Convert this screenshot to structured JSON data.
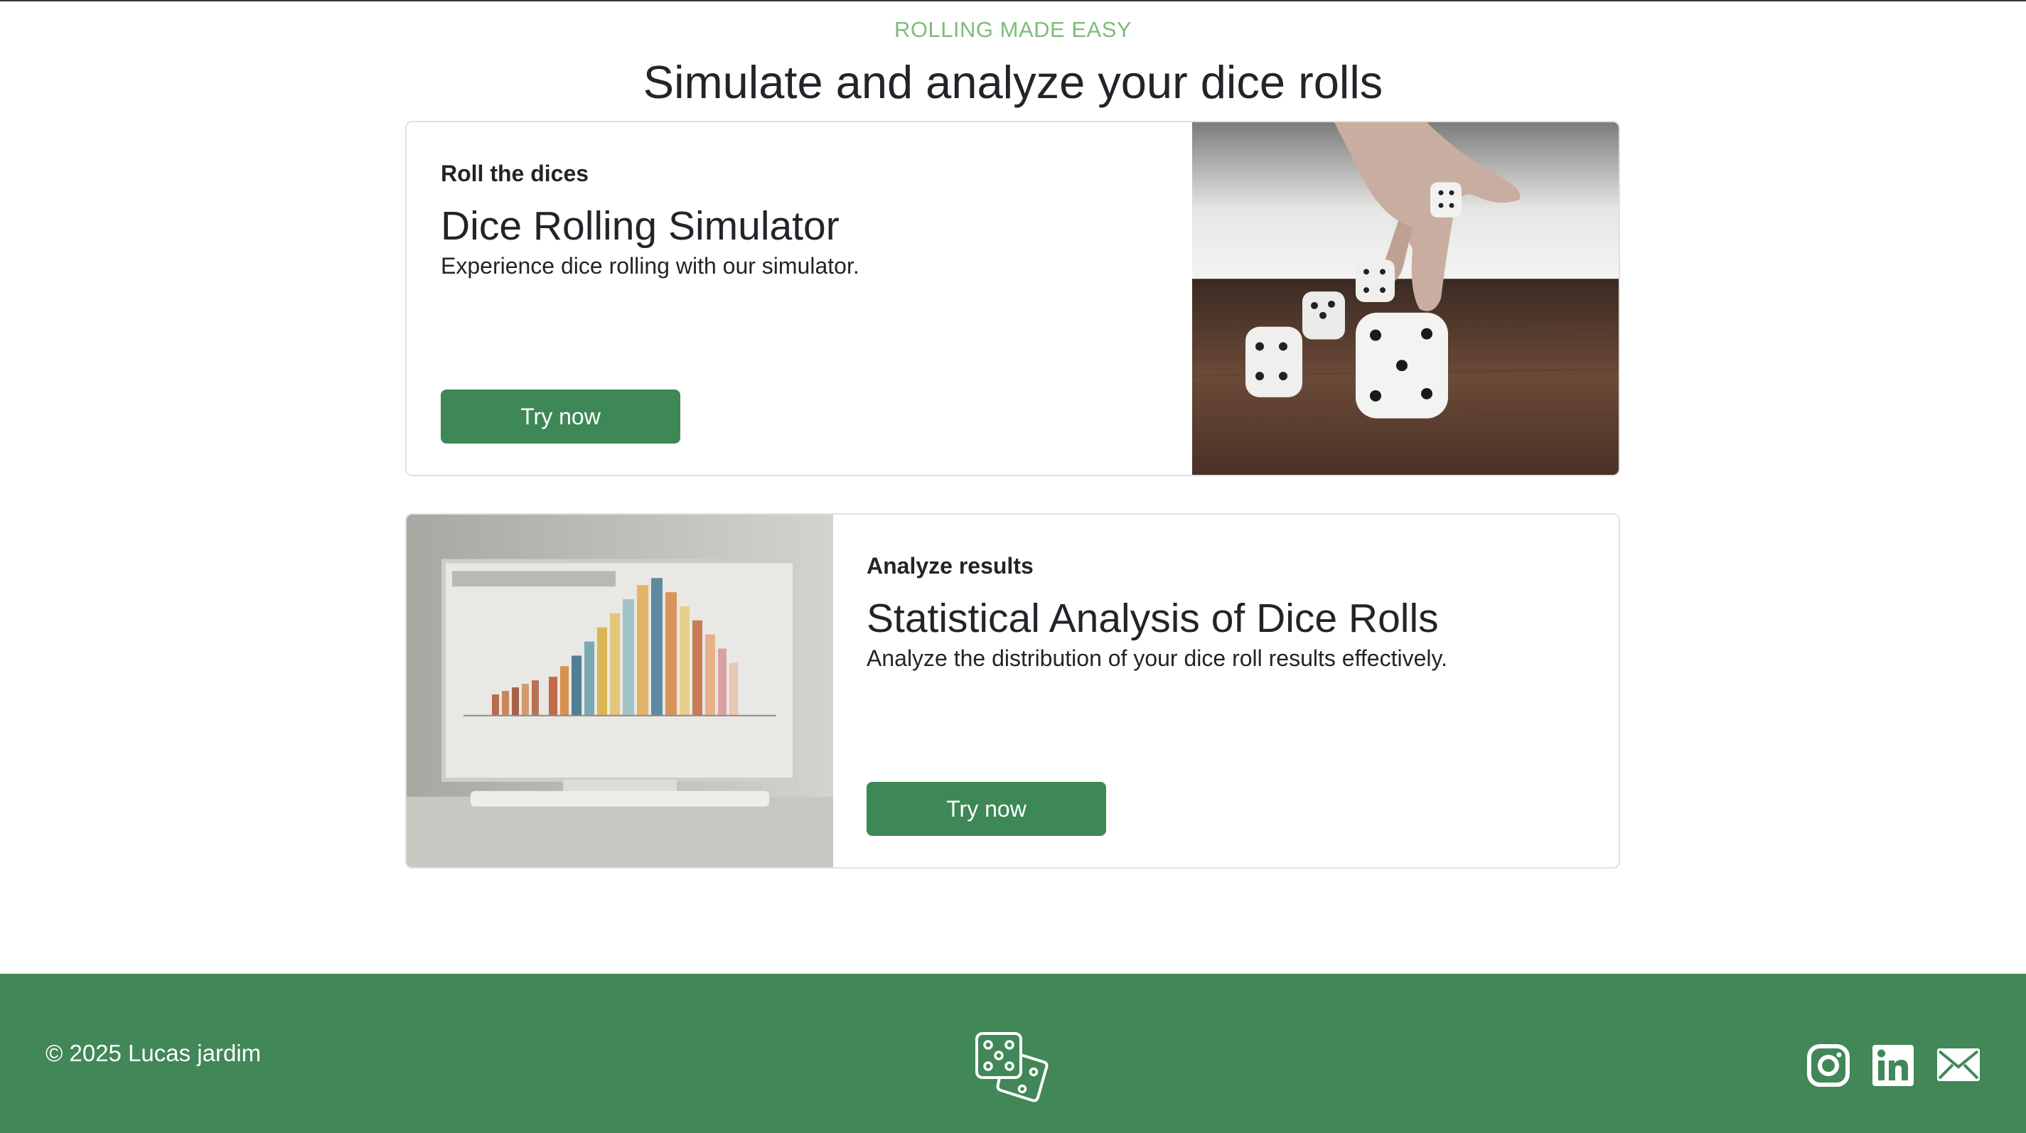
{
  "hero": {
    "eyebrow": "ROLLING MADE EASY",
    "headline": "Simulate and analyze your dice rolls"
  },
  "cards": [
    {
      "kicker": "Roll the dices",
      "title": "Dice Rolling Simulator",
      "text": "Experience dice rolling with our simulator.",
      "button": "Try now",
      "image": "dice-photo"
    },
    {
      "kicker": "Analyze results",
      "title": "Statistical Analysis of Dice Rolls",
      "text": "Analyze the distribution of your dice roll results effectively.",
      "button": "Try now",
      "image": "chart-monitor-photo"
    }
  ],
  "footer": {
    "copyright": "© 2025 Lucas jardim",
    "logo_icon": "dice-icon",
    "social": [
      "instagram-icon",
      "linkedin-icon",
      "mail-icon"
    ]
  },
  "colors": {
    "accent": "#3e8757",
    "footer_bg": "#418758",
    "eyebrow": "#7dbd79"
  }
}
